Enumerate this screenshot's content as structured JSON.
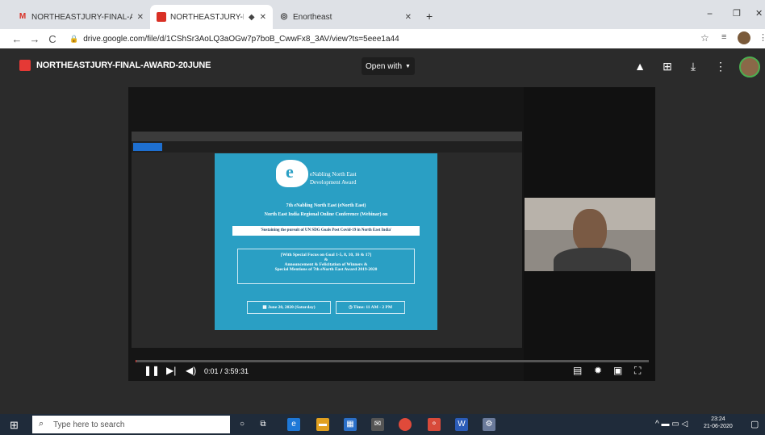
{
  "tabs": [
    {
      "label": "NORTHEASTJURY-FINAL-AWARD",
      "icon": "gmail-icon"
    },
    {
      "label": "NORTHEASTJURY-FINAL-AW",
      "icon": "drive-file-icon"
    },
    {
      "label": "Enortheast",
      "icon": "web-icon"
    }
  ],
  "address": {
    "url": "drive.google.com/file/d/1CShSr3AoLQ3aOGw7p7boB_CwwFx8_3AV/view?ts=5eee1a44"
  },
  "drive": {
    "file_title": "NORTHEASTJURY-FINAL-AWARD-20JUNE",
    "open_with_label": "Open with"
  },
  "slide": {
    "logo_line1": "eNabling North East",
    "logo_line2": "Development Award",
    "title1": "7th eNabling North East (eNorth East)",
    "title2": "North East India Regional Online Conference (Webinar) on",
    "theme": "'Sustaining the pursuit of UN SDG Goals Post Covid-19 in North East India'",
    "focus": "[With Special Focus on Goal 1-5, 8, 10, 16 & 17]",
    "amp": "&",
    "announce1": "Announcement & Felicitation of Winners &",
    "announce2": "Special Mentions of 7th eNorth East Award 2019-2020",
    "date": "June 20, 2020 (Saturday)",
    "time": "Time: 11 AM - 2 PM"
  },
  "player": {
    "time": "0:01 / 3:59:31"
  },
  "taskbar": {
    "search_placeholder": "Type here to search",
    "clock_time": "23:24",
    "clock_date": "21-06-2020"
  }
}
